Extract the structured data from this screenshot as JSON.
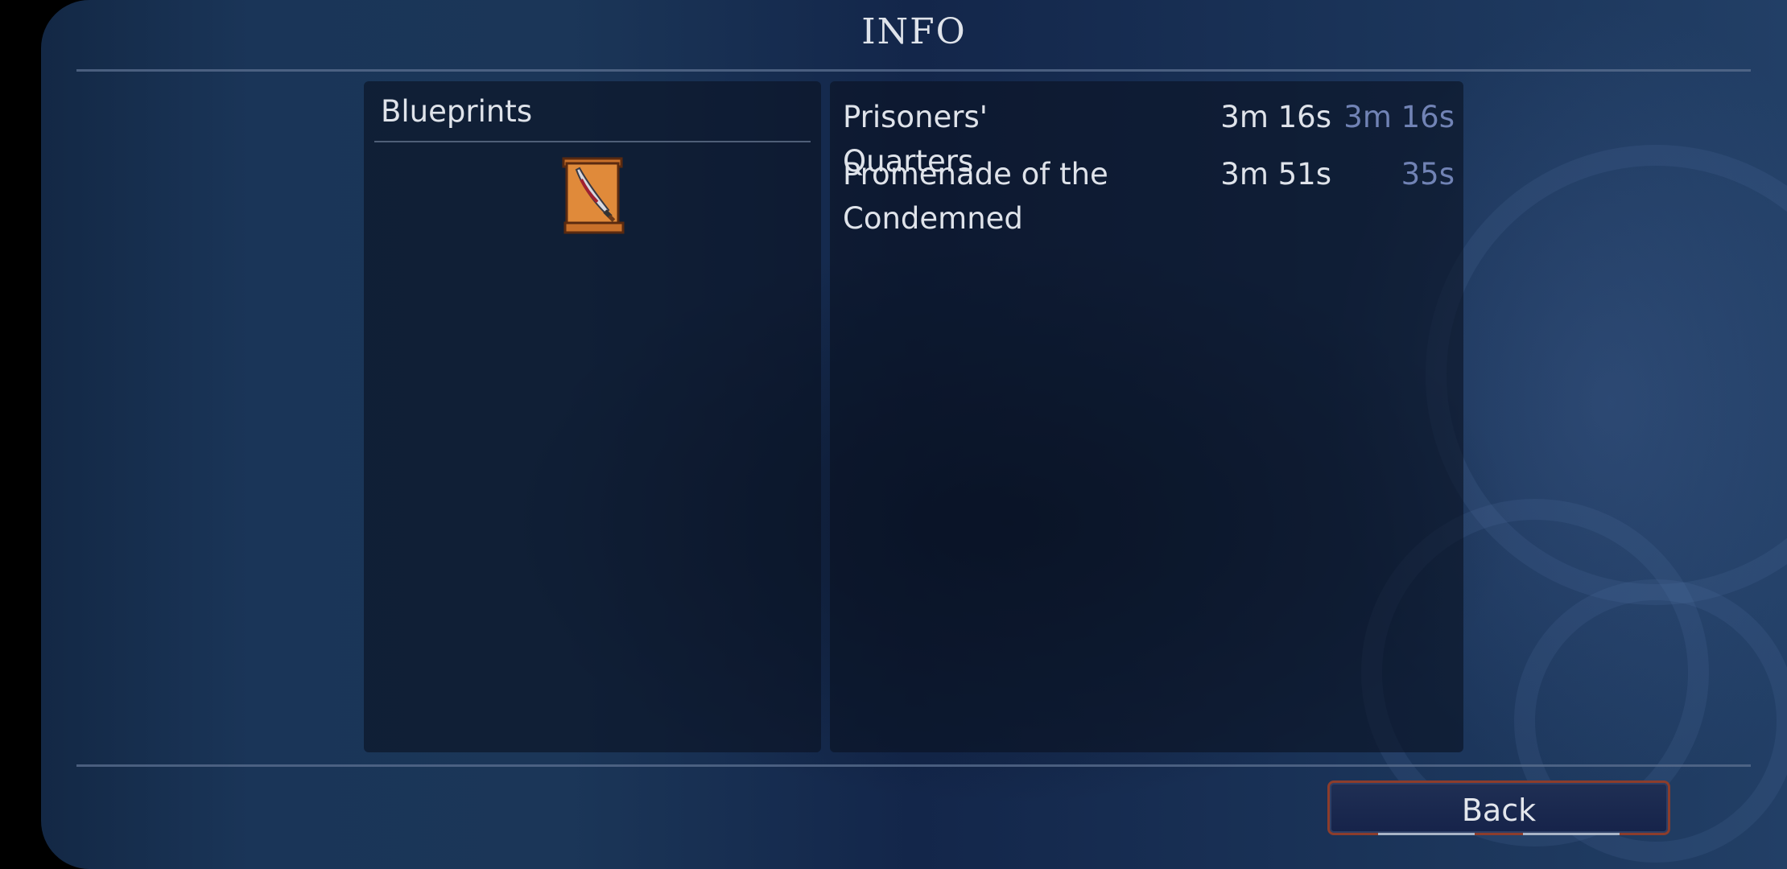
{
  "header": {
    "title": "INFO"
  },
  "blueprints_panel": {
    "title": "Blueprints",
    "items": [
      {
        "icon": "blueprint-scroll-icon"
      }
    ]
  },
  "biomes_panel": {
    "rows": [
      {
        "name": "Prisoners' Quarters",
        "time": "3m 16s",
        "best": "3m 16s"
      },
      {
        "name": "Promenade of the Condemned",
        "time": "3m 51s",
        "best": "35s"
      }
    ]
  },
  "footer": {
    "back_label": "Back"
  },
  "colors": {
    "background": "#1a3358",
    "panel": "#0f1a2e",
    "text": "#dfe3ea",
    "best_time": "#7183b5",
    "button_border": "#8c3d2c"
  }
}
